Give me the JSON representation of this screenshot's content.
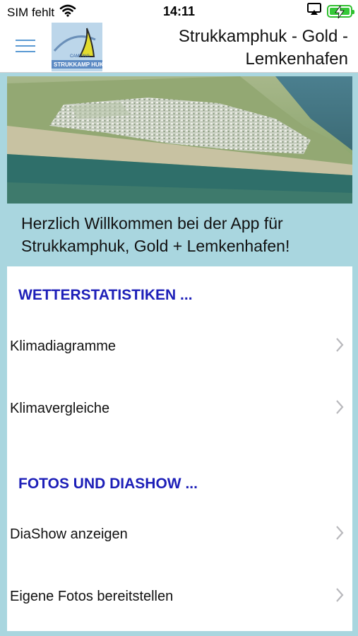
{
  "status": {
    "carrier": "SIM fehlt",
    "time": "14:11"
  },
  "header": {
    "title": "Strukkamphuk - Gold - Lemkenhafen",
    "logo_top": "CAMPING",
    "logo_bottom": "STRUKKAMP HUK"
  },
  "welcome": {
    "text": "Herzlich Willkommen bei der App für Strukkamphuk, Gold + Lemkenhafen!"
  },
  "sections": [
    {
      "title": "WETTERSTATISTIKEN ...",
      "items": [
        {
          "label": "Klimadiagramme"
        },
        {
          "label": "Klimavergleiche"
        }
      ]
    },
    {
      "title": "FOTOS UND DIASHOW ...",
      "items": [
        {
          "label": "DiaShow anzeigen"
        },
        {
          "label": "Eigene Fotos bereitstellen"
        }
      ]
    }
  ],
  "colors": {
    "accent_blue": "#1d1fb8",
    "background": "#a9d6df",
    "menu_icon": "#5b9ad3"
  },
  "icons": [
    "wifi-icon",
    "airplay-icon",
    "battery-icon",
    "menu-icon",
    "chevron-right-icon"
  ]
}
